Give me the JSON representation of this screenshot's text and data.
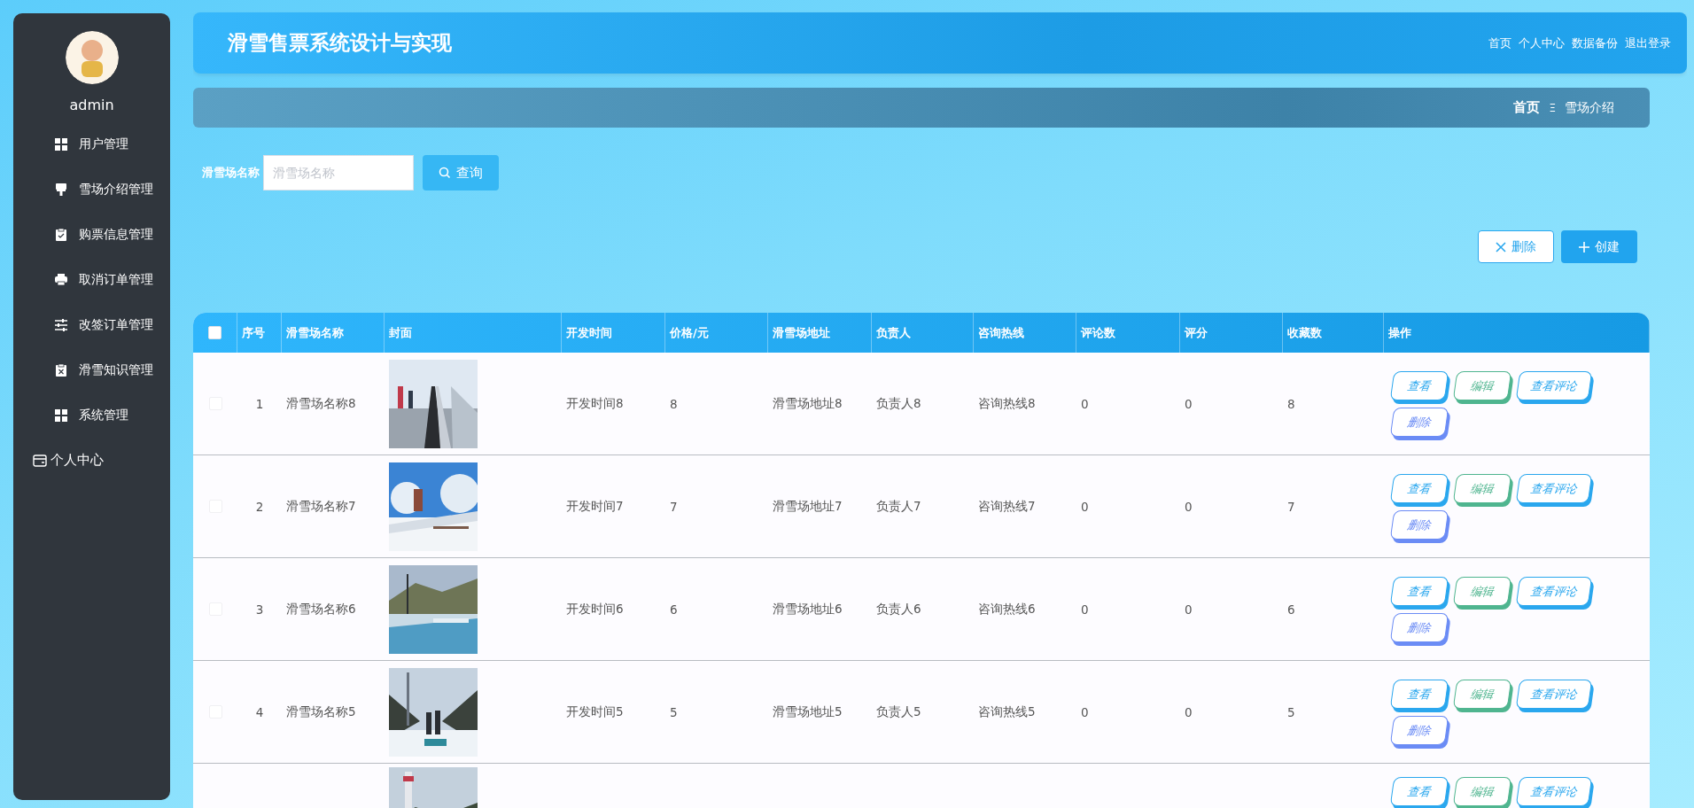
{
  "sidebar": {
    "user": {
      "name": "admin"
    },
    "items": [
      {
        "label": "用户管理",
        "selected": false
      },
      {
        "label": "雪场介绍管理",
        "selected": false
      },
      {
        "label": "购票信息管理",
        "selected": false
      },
      {
        "label": "取消订单管理",
        "selected": false
      },
      {
        "label": "改签订单管理",
        "selected": false
      },
      {
        "label": "滑雪知识管理",
        "selected": false
      },
      {
        "label": "系统管理",
        "selected": false
      },
      {
        "label": "个人中心",
        "selected": false
      }
    ]
  },
  "header": {
    "title": "滑雪售票系统设计与实现",
    "links": [
      "首页",
      "个人中心",
      "数据备份",
      "退出登录"
    ]
  },
  "breadcrumb": {
    "items": [
      "首页",
      "雪场介绍"
    ],
    "separator": "Ξ"
  },
  "search": {
    "label": "滑雪场名称",
    "placeholder": "滑雪场名称",
    "button": "查询"
  },
  "toolbar": [
    {
      "kind": "delete",
      "label": "删除"
    },
    {
      "kind": "create",
      "label": "创建"
    }
  ],
  "table": {
    "select_all": {
      "checked": false
    },
    "columns": [
      "序号",
      "滑雪场名称",
      "封面",
      "开发时间",
      "价格/元",
      "滑雪场地址",
      "负责人",
      "咨询热线",
      "评论数",
      "评分",
      "收藏数",
      "操作"
    ],
    "rows": [
      {
        "selected": false,
        "cells": [
          "1",
          "滑雪场名称8",
          null,
          "开发时间8",
          "8",
          "滑雪场地址8",
          "负责人8",
          "咨询热线8",
          "0",
          "0",
          "8"
        ],
        "cover": {
          "kind": "picture"
        },
        "actions": [
          {
            "label": "查看",
            "color": "#2aa7ee"
          },
          {
            "label": "编辑",
            "color": "#4fb58f"
          },
          {
            "label": "查看评论",
            "color": "#2aa7ee"
          },
          {
            "label": "删除",
            "color": "#6b8cf5"
          }
        ]
      },
      {
        "selected": false,
        "cells": [
          "2",
          "滑雪场名称7",
          null,
          "开发时间7",
          "7",
          "滑雪场地址7",
          "负责人7",
          "咨询热线7",
          "0",
          "0",
          "7"
        ],
        "cover": {
          "kind": "picture"
        },
        "actions": [
          {
            "label": "查看",
            "color": "#2aa7ee"
          },
          {
            "label": "编辑",
            "color": "#4fb58f"
          },
          {
            "label": "查看评论",
            "color": "#2aa7ee"
          },
          {
            "label": "删除",
            "color": "#6b8cf5"
          }
        ]
      },
      {
        "selected": false,
        "cells": [
          "3",
          "滑雪场名称6",
          null,
          "开发时间6",
          "6",
          "滑雪场地址6",
          "负责人6",
          "咨询热线6",
          "0",
          "0",
          "6"
        ],
        "cover": {
          "kind": "picture"
        },
        "actions": [
          {
            "label": "查看",
            "color": "#2aa7ee"
          },
          {
            "label": "编辑",
            "color": "#4fb58f"
          },
          {
            "label": "查看评论",
            "color": "#2aa7ee"
          },
          {
            "label": "删除",
            "color": "#6b8cf5"
          }
        ]
      },
      {
        "selected": false,
        "cells": [
          "4",
          "滑雪场名称5",
          null,
          "开发时间5",
          "5",
          "滑雪场地址5",
          "负责人5",
          "咨询热线5",
          "0",
          "0",
          "5"
        ],
        "cover": {
          "kind": "picture"
        },
        "actions": [
          {
            "label": "查看",
            "color": "#2aa7ee"
          },
          {
            "label": "编辑",
            "color": "#4fb58f"
          },
          {
            "label": "查看评论",
            "color": "#2aa7ee"
          },
          {
            "label": "删除",
            "color": "#6b8cf5"
          }
        ]
      },
      {
        "cover": {
          "kind": "picture"
        },
        "actions": [
          {
            "label": "查看",
            "color": "#2aa7ee"
          },
          {
            "label": "编辑",
            "color": "#4fb58f"
          },
          {
            "label": "查看评论",
            "color": "#2aa7ee"
          }
        ]
      }
    ]
  }
}
